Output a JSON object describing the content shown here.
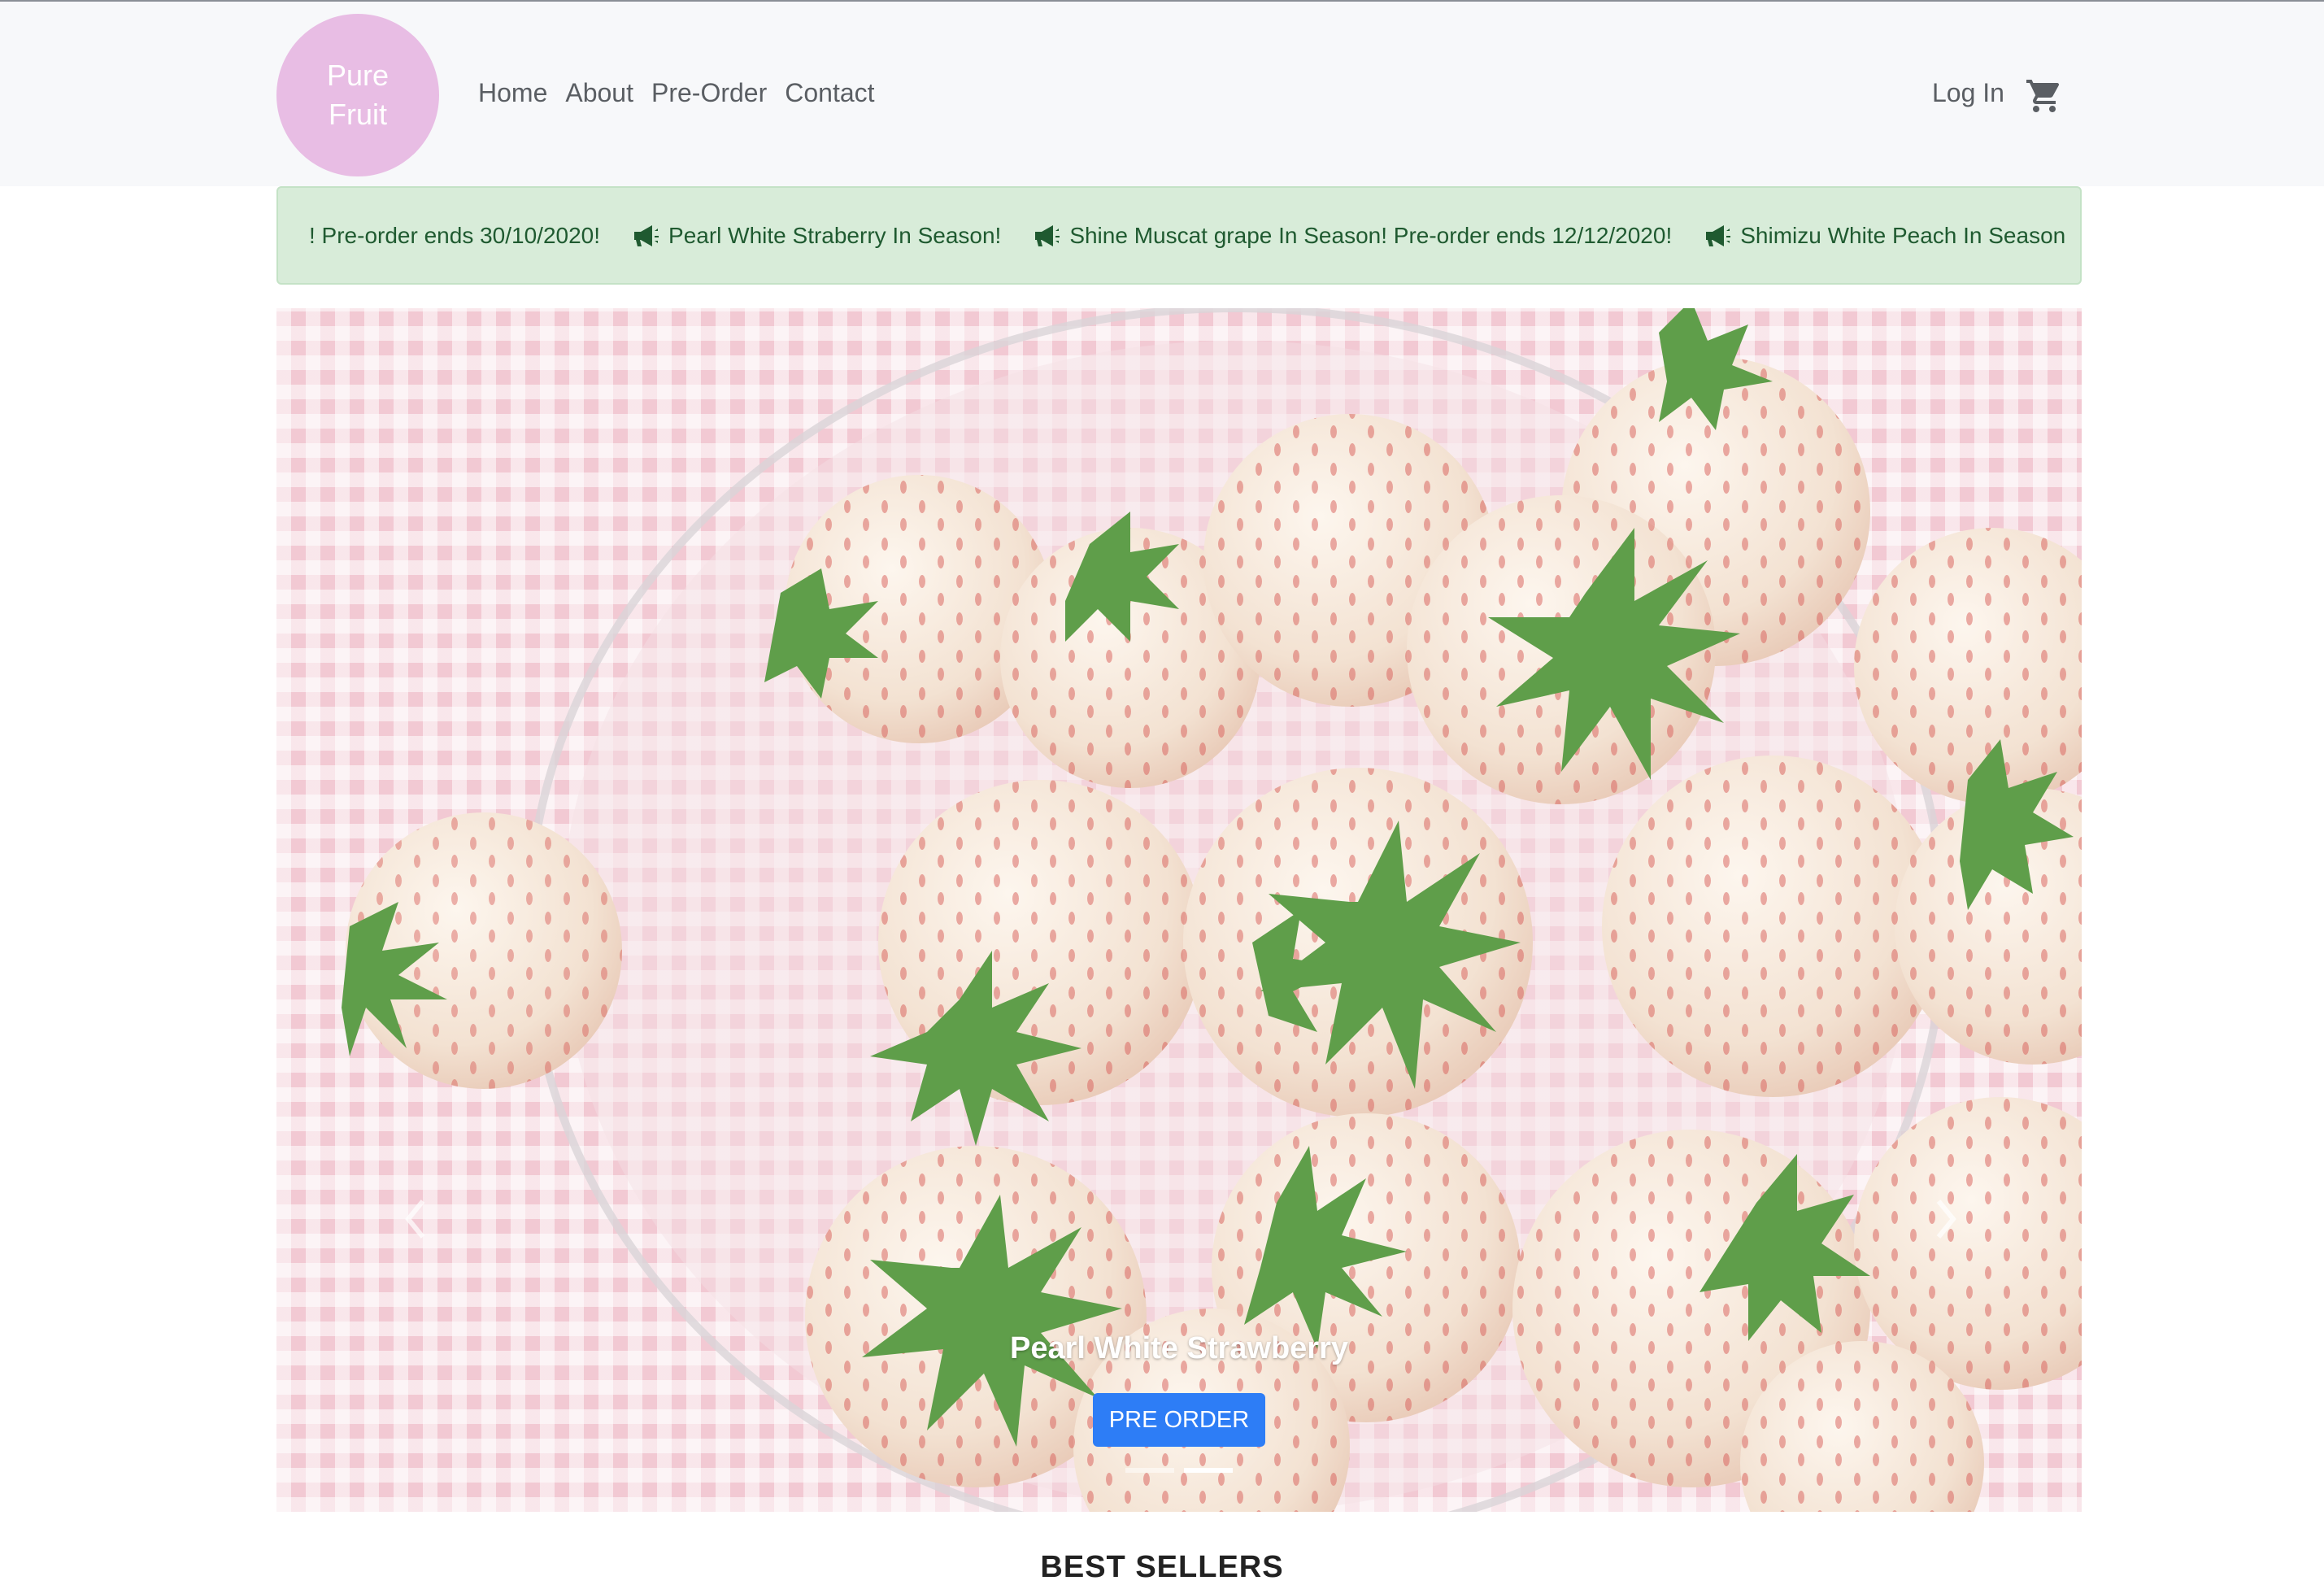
{
  "logo": {
    "line1": "Pure",
    "line2": "Fruit"
  },
  "nav": {
    "links": [
      "Home",
      "About",
      "Pre-Order",
      "Contact"
    ],
    "login": "Log In",
    "cart_icon": "cart-icon"
  },
  "ticker": {
    "items": [
      "! Pre-order ends 30/10/2020!",
      "Pearl White Straberry In Season!",
      "Shine Muscat grape In Season! Pre-order ends 12/12/2020!",
      "Shimizu White Peach In Season"
    ],
    "icon": "megaphone-icon"
  },
  "carousel": {
    "caption": "Pearl White Strawberry",
    "button": "PRE ORDER",
    "slide_count": 2,
    "active_slide": 2
  },
  "section": {
    "title": "BEST SELLERS"
  },
  "colors": {
    "logo_bg": "#e8bde4",
    "ticker_bg": "#d8ecd9",
    "button_bg": "#2d7df6"
  }
}
